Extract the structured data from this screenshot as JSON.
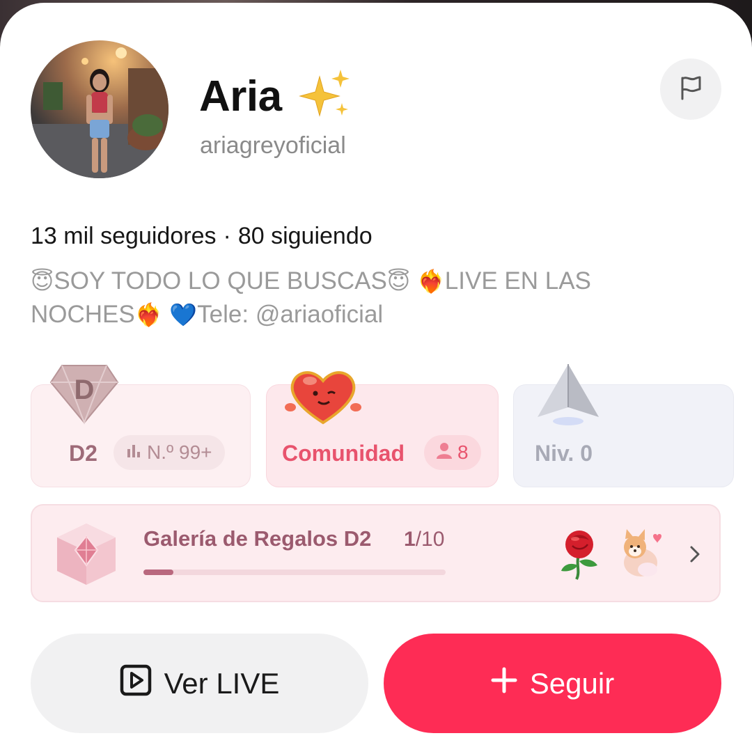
{
  "profile": {
    "name": "Aria",
    "handle": "ariagreyoficial",
    "followers": "13 mil seguidores",
    "separator": "·",
    "following": "80 siguiendo",
    "bio_line1_text1": "SOY TODO LO QUE BUSCAS",
    "bio_line1_text2": "LIVE EN LAS",
    "bio_line2_text1": "NOCHES",
    "bio_line2_text2": "Tele: @ariaoficial",
    "emoji_angel": "😇",
    "emoji_fire_heart": "❤️‍🔥",
    "emoji_blue_heart": "💙"
  },
  "badges": {
    "rank": {
      "label": "D2",
      "icon_letter": "D",
      "pill": "N.º 99+"
    },
    "community": {
      "label": "Comunidad",
      "count": "8"
    },
    "level": {
      "label": "Niv. 0"
    }
  },
  "gallery": {
    "title": "Galería de Regalos D2",
    "count_current": "1",
    "count_total": "/10",
    "progress": 0.1
  },
  "actions": {
    "watch_live": "Ver LIVE",
    "follow": "Seguir"
  },
  "colors": {
    "follow": "#fe2c55",
    "rank": "#9e6a78",
    "community": "#e8536d",
    "level": "#a8aab6"
  },
  "icons": [
    "sparkles-icon",
    "flag-icon",
    "diamond-rank-icon",
    "bar-chart-icon",
    "heart-mascot-icon",
    "person-icon",
    "level-arrow-icon",
    "gift-cube-icon",
    "rose-icon",
    "corgi-icon",
    "chevron-right-icon",
    "live-play-icon",
    "plus-icon"
  ]
}
